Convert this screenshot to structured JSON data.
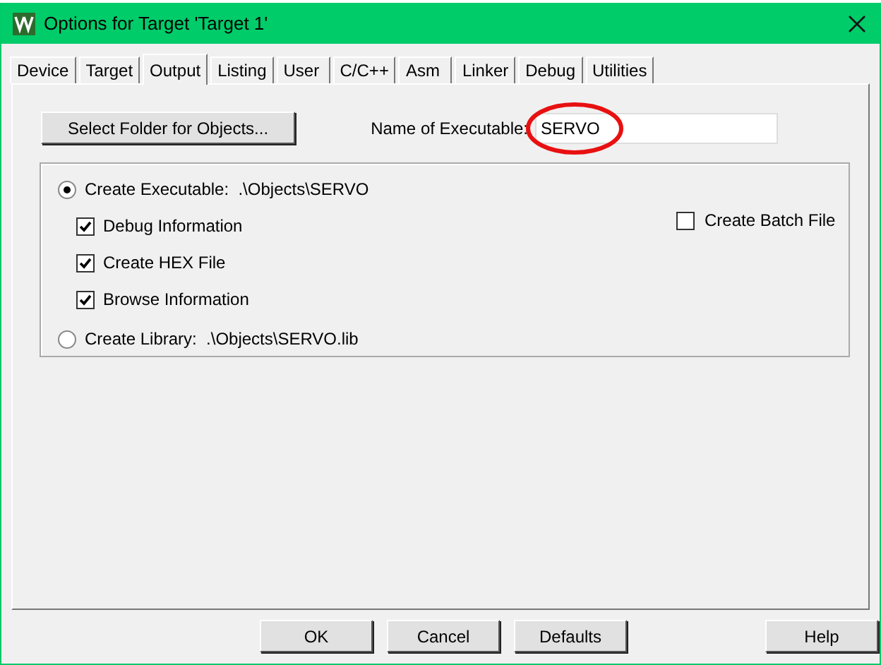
{
  "window": {
    "title": "Options for Target 'Target 1'"
  },
  "tabs": [
    {
      "label": "Device",
      "selected": false
    },
    {
      "label": "Target",
      "selected": false
    },
    {
      "label": "Output",
      "selected": true
    },
    {
      "label": "Listing",
      "selected": false
    },
    {
      "label": "User",
      "selected": false
    },
    {
      "label": "C/C++",
      "selected": false
    },
    {
      "label": "Asm",
      "selected": false
    },
    {
      "label": "Linker",
      "selected": false
    },
    {
      "label": "Debug",
      "selected": false
    },
    {
      "label": "Utilities",
      "selected": false
    }
  ],
  "select_folder_button": "Select Folder for Objects...",
  "name_of_executable": {
    "label": "Name of Executable:",
    "value": "SERVO"
  },
  "create_executable": {
    "label": "Create Executable:  .\\Objects\\SERVO",
    "selected": true
  },
  "options": [
    {
      "label": "Debug Information",
      "checked": true
    },
    {
      "label": "Create HEX File",
      "checked": true
    },
    {
      "label": "Browse Information",
      "checked": true
    }
  ],
  "create_batch_file": {
    "label": "Create Batch File",
    "checked": false
  },
  "create_library": {
    "label": "Create Library:  .\\Objects\\SERVO.lib",
    "selected": false
  },
  "buttons": [
    "OK",
    "Cancel",
    "Defaults"
  ],
  "help_button": "Help"
}
